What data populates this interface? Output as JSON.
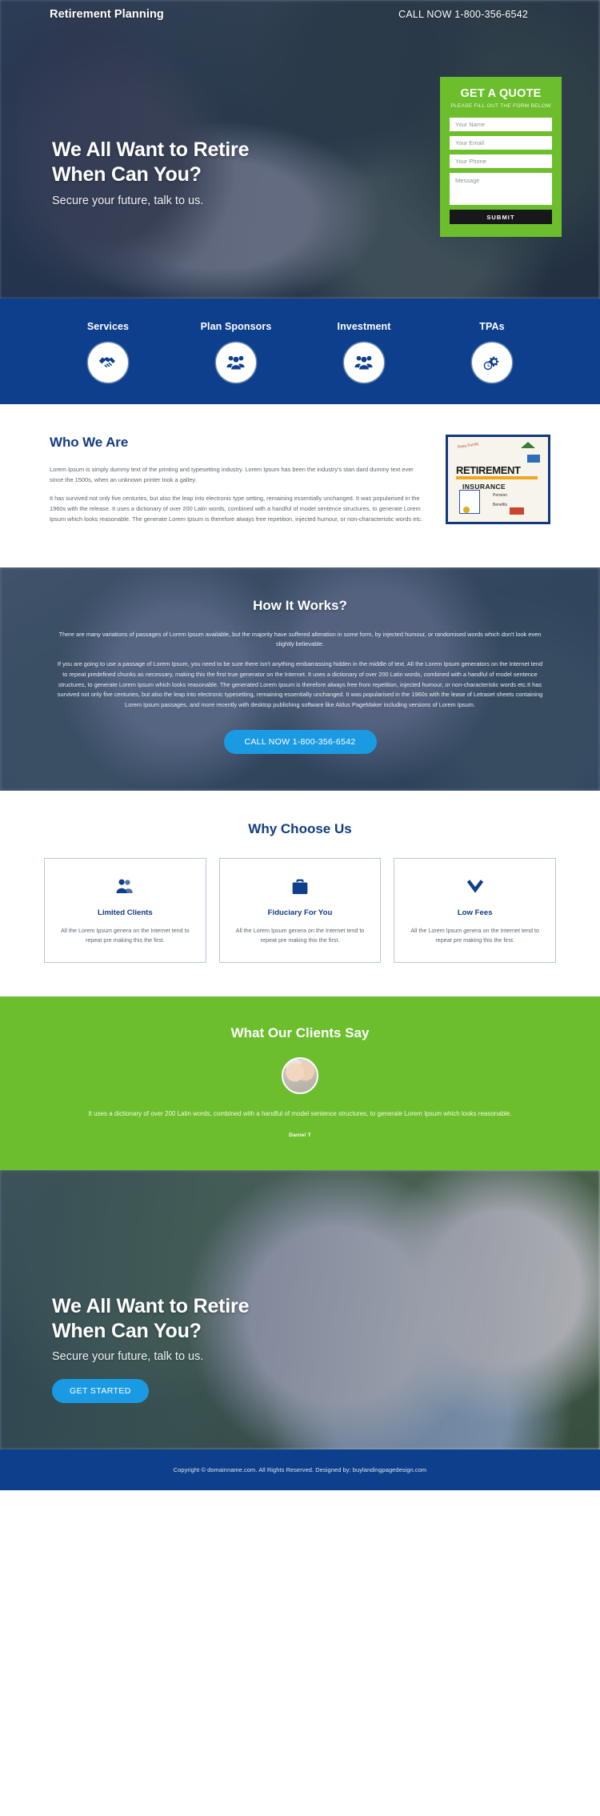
{
  "header": {
    "brand": "Retirement Planning",
    "call_now": "CALL NOW 1-800-356-6542"
  },
  "hero": {
    "headline_line1": "We All Want to Retire",
    "headline_line2": "When Can You?",
    "subheadline": "Secure your future, talk to us."
  },
  "quote_form": {
    "title": "GET A QUOTE",
    "subtitle": "PLEASE FILL OUT THE FORM BELOW",
    "name_placeholder": "Your Name",
    "email_placeholder": "Your Email",
    "phone_placeholder": "Your Phone",
    "message_placeholder": "Message",
    "name_value": "",
    "email_value": "",
    "phone_value": "",
    "message_value": "",
    "submit_label": "SUBMIT",
    "accent_color": "#6cbe2c",
    "submit_color": "#17181a"
  },
  "services": {
    "items": [
      {
        "label": "Services",
        "icon": "handshake-icon"
      },
      {
        "label": "Plan Sponsors",
        "icon": "people-group-icon"
      },
      {
        "label": "Investment",
        "icon": "people-group-icon"
      },
      {
        "label": "TPAs",
        "icon": "gear-clock-icon"
      }
    ],
    "bg_color": "#0e3f8c"
  },
  "who_we_are": {
    "title": "Who We Are",
    "paragraph1": "Lorem Ipsum is simply dummy text of the printing and typesetting industry. Lorem Ipsum has been the industry's stan dard dummy text ever since the 1500s, when an unknown printer took a galley.",
    "paragraph2": "It has survived not only five centuries, but also the leap into electronic type setting, remaining essentially unchanged. It was popularised in the 1960s with the release. It uses a dictionary of over 200 Latin words, combined with a handful of model sentence structures, to generate Lorem Ipsum which looks reasonable. The generate Lorem Ipsum is therefore always free repetition, injected humour, or non-characteristic words etc.",
    "image": {
      "word_retirement": "RETIREMENT",
      "word_insurance": "INSURANCE",
      "word_pension": "Pension",
      "word_benefits": "Benefits",
      "word_scribble": "Fees Funds"
    }
  },
  "how_it_works": {
    "title": "How It Works?",
    "paragraph1": "There are many variations of passages of Lorem Ipsum available, but the majority have suffered alteration in some form, by injected humour, or randomised words which don't look even slightly believable.",
    "paragraph2": "If you are going to use a passage of Lorem Ipsum, you need to be sure there isn't anything embarrassing hidden in the middle of text. All the Lorem Ipsum generators on the Internet tend to repeat predefined chunks as necessary, making this the first true generator on the Internet. It uses a dictionary of over 200 Latin words, combined with a handful of model sentence structures, to generate Lorem Ipsum which looks reasonable. The generated Lorem Ipsum is therefore always free from repetition, injected humour, or non-characteristic words etc.It has survived not only five centuries, but also the leap into electronic typesetting, remaining essentially unchanged. It was popularised in the 1960s with the lease of Letraset sheets containing Lorem Ipsum passages, and more recently with desktop publishing software like Aldus PageMaker including versions of Lorem Ipsum.",
    "button_label": "CALL NOW 1-800-356-6542",
    "button_color": "#1b9ae4"
  },
  "why_choose_us": {
    "title": "Why Choose Us",
    "cards": [
      {
        "title": "Limited Clients",
        "text": "All the Lorem Ipsum genera on the Internet tend to repeat pre making this the first.",
        "icon": "two-users-icon"
      },
      {
        "title": "Fiduciary For You",
        "text": "All the Lorem Ipsum genera on the Internet tend to repeat pre making this the first.",
        "icon": "briefcase-icon"
      },
      {
        "title": "Low Fees",
        "text": "All the Lorem Ipsum genera on the Internet tend to repeat pre making this the first.",
        "icon": "chevron-down-icon"
      }
    ],
    "border_color": "#b9c6da",
    "title_color": "#123b7e"
  },
  "testimonial": {
    "title": "What Our Clients Say",
    "quote": "It uses a dictionary of over 200 Latin words, combined with a handful of model sentence structures, to generate Lorem Ipsum which looks reasonable.",
    "author": "Daniel T",
    "bg_color": "#6cbe2c"
  },
  "cta": {
    "headline_line1": "We All Want to Retire",
    "headline_line2": "When Can You?",
    "subheadline": "Secure your future, talk to us.",
    "button_label": "GET STARTED",
    "button_color": "#1b9ae4"
  },
  "footer": {
    "text": "Copyright © domainname.com. All Rights Reserved. Designed by: buylandingpagedesign.com",
    "bg_color": "#0e3f8c"
  }
}
